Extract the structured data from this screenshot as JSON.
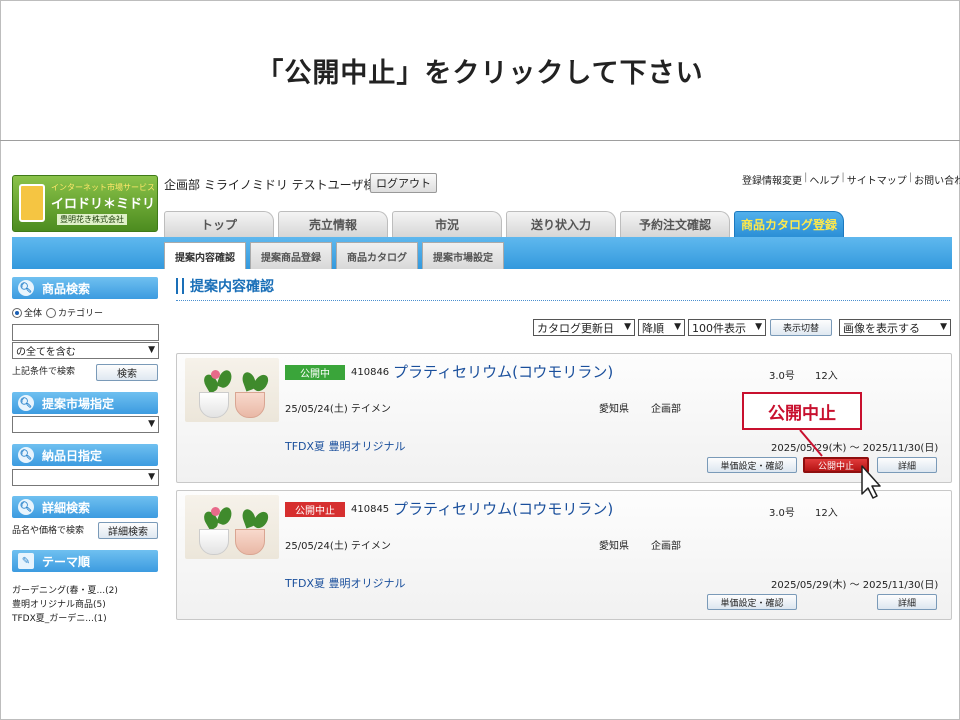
{
  "slide": {
    "title": "「公開中止」をクリックして下さい"
  },
  "header": {
    "logo": {
      "sub": "インターネット市場サービス",
      "main": "イロドリ＊ミドリ",
      "company": "豊明花き株式会社"
    },
    "user_name": "企画部 ミライノミドリ テストユーザ様",
    "logout": "ログアウト",
    "top_links": [
      "登録情報変更",
      "ヘルプ",
      "サイトマップ",
      "お問い合わせ"
    ]
  },
  "main_tabs": [
    "トップ",
    "売立情報",
    "市況",
    "送り状入力",
    "予約注文確認",
    "商品カタログ登録"
  ],
  "sub_tabs": [
    "提案内容確認",
    "提案商品登録",
    "商品カタログ",
    "提案市場設定"
  ],
  "sidebar": {
    "product_search": {
      "heading": "商品検索",
      "radio_all": "全体",
      "radio_category": "カテゴリー",
      "match_select": "の全てを含む",
      "hint": "上記条件で検索",
      "search_button": "検索"
    },
    "market_heading": "提案市場指定",
    "delivery_heading": "納品日指定",
    "detail_search": {
      "heading": "詳細検索",
      "hint": "品名や価格で検索",
      "button": "詳細検索"
    },
    "theme": {
      "heading": "テーマ順",
      "items": [
        "ガーデニング(春・夏...(2)",
        "豊明オリジナル商品(5)",
        "TFDX夏_ガーデニ...(1)"
      ]
    }
  },
  "content": {
    "section_title": "提案内容確認",
    "controls": {
      "sort_field": "カタログ更新日",
      "order": "降順",
      "per_page": "100件表示",
      "toggle": "表示切替",
      "image": "画像を表示する"
    },
    "items": [
      {
        "status": "公開中",
        "code": "410846",
        "name": "プラティセリウム(コウモリラン)",
        "size": "3.0号",
        "qty": "12入",
        "date": "25/05/24(土) テイメン",
        "prefecture": "愛知県",
        "dept": "企画部",
        "tags": "TFDX夏 豊明オリジナル",
        "period": "2025/05/29(木) ～ 2025/11/30(日)",
        "buttons": {
          "price": "単価設定・確認",
          "stop": "公開中止",
          "detail": "詳細"
        }
      },
      {
        "status": "公開中止",
        "code": "410845",
        "name": "プラティセリウム(コウモリラン)",
        "size": "3.0号",
        "qty": "12入",
        "date": "25/05/24(土) テイメン",
        "prefecture": "愛知県",
        "dept": "企画部",
        "tags": "TFDX夏 豊明オリジナル",
        "period": "2025/05/29(木) ～ 2025/11/30(日)",
        "buttons": {
          "price": "単価設定・確認",
          "detail": "詳細"
        }
      }
    ]
  },
  "callout": {
    "text": "公開中止",
    "color": "#c8102e"
  }
}
